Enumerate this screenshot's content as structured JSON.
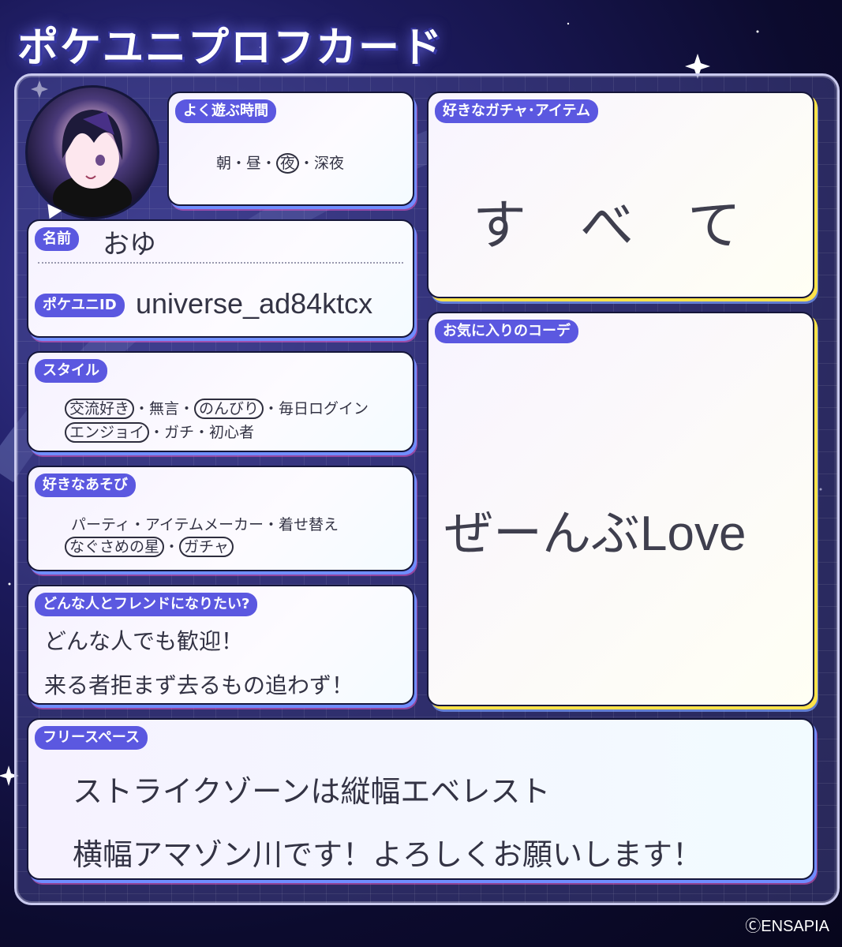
{
  "header": {
    "title": "ポケユニプロフカード"
  },
  "play_time": {
    "label": "よく遊ぶ時間",
    "opt1": "朝・昼・",
    "opt2": "夜",
    "opt3": "・深夜"
  },
  "profile": {
    "name_label": "名前",
    "name": "おゆ",
    "id_label": "ポケユニID",
    "id": "universe_ad84ktcx"
  },
  "style": {
    "label": "スタイル",
    "c1": "交流好き",
    "t1": "・無言・",
    "c2": "のんびり",
    "t2": "・毎日ログイン",
    "c3": "エンジョイ",
    "t3": "・ガチ・初心者"
  },
  "favorite_play": {
    "label": "好きなあそび",
    "line1": "パーティ・アイテムメーカー・着せ替え",
    "c1": "なぐさめの星",
    "sep": "・",
    "c2": "ガチャ"
  },
  "friend": {
    "label": "どんな人とフレンドになりたい?",
    "line1": "どんな人でも歓迎！",
    "line2": "来る者拒まず去るもの追わず！"
  },
  "gacha": {
    "label": "好きなガチャ･アイテム",
    "value": "す　べ　て"
  },
  "coord": {
    "label": "お気に入りのコーデ",
    "value": "ぜーんぶLove"
  },
  "free": {
    "label": "フリースペース",
    "line1": "ストライクゾーンは縦幅エベレスト",
    "line2": "横幅アマゾン川です！よろしくお願いします！"
  },
  "footer": {
    "copyright": "ⒸENSAPIA"
  }
}
